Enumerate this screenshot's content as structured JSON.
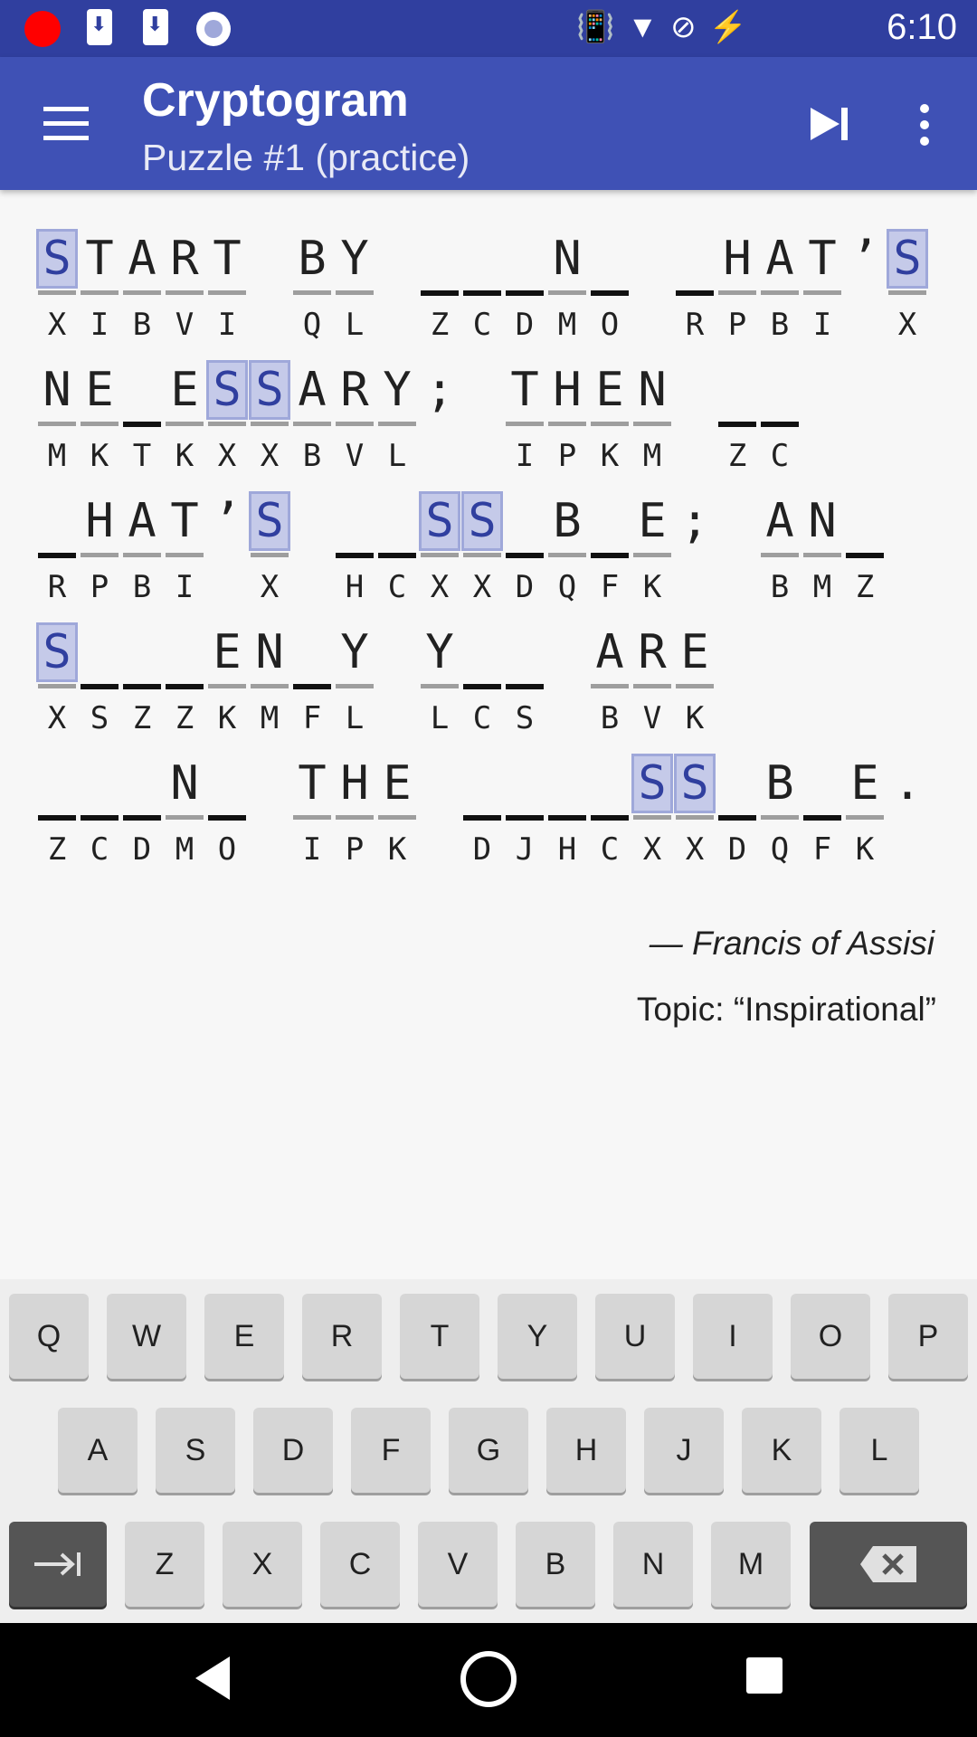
{
  "status_bar": {
    "time": "6:10"
  },
  "app_bar": {
    "title": "Cryptogram",
    "subtitle": "Puzzle #1 (practice)"
  },
  "puzzle": {
    "lines": [
      [
        {
          "p": "S",
          "c": "X",
          "hl": true
        },
        {
          "p": "T",
          "c": "I"
        },
        {
          "p": "A",
          "c": "B"
        },
        {
          "p": "R",
          "c": "V"
        },
        {
          "p": "T",
          "c": "I"
        },
        {
          "sp": true
        },
        {
          "p": "B",
          "c": "Q"
        },
        {
          "p": "Y",
          "c": "L"
        },
        {
          "sp": true
        },
        {
          "p": "",
          "c": "Z"
        },
        {
          "p": "",
          "c": "C"
        },
        {
          "p": "",
          "c": "D"
        },
        {
          "p": "N",
          "c": "M"
        },
        {
          "p": "",
          "c": "O"
        },
        {
          "sp": true
        },
        {
          "p": "",
          "c": "R"
        },
        {
          "p": "H",
          "c": "P"
        },
        {
          "p": "A",
          "c": "B"
        },
        {
          "p": "T",
          "c": "I"
        },
        {
          "p": "’",
          "punct": true
        },
        {
          "p": "S",
          "c": "X",
          "hl": true
        }
      ],
      [
        {
          "p": "N",
          "c": "M"
        },
        {
          "p": "E",
          "c": "K"
        },
        {
          "p": "",
          "c": "T"
        },
        {
          "p": "E",
          "c": "K"
        },
        {
          "p": "S",
          "c": "X",
          "hl": true
        },
        {
          "p": "S",
          "c": "X",
          "hl": true
        },
        {
          "p": "A",
          "c": "B"
        },
        {
          "p": "R",
          "c": "V"
        },
        {
          "p": "Y",
          "c": "L"
        },
        {
          "p": ";",
          "punct": true
        },
        {
          "sp": true
        },
        {
          "p": "T",
          "c": "I"
        },
        {
          "p": "H",
          "c": "P"
        },
        {
          "p": "E",
          "c": "K"
        },
        {
          "p": "N",
          "c": "M"
        },
        {
          "sp": true
        },
        {
          "p": "",
          "c": "Z"
        },
        {
          "p": "",
          "c": "C"
        }
      ],
      [
        {
          "p": "",
          "c": "R"
        },
        {
          "p": "H",
          "c": "P"
        },
        {
          "p": "A",
          "c": "B"
        },
        {
          "p": "T",
          "c": "I"
        },
        {
          "p": "’",
          "punct": true
        },
        {
          "p": "S",
          "c": "X",
          "hl": true
        },
        {
          "sp": true
        },
        {
          "p": "",
          "c": "H"
        },
        {
          "p": "",
          "c": "C"
        },
        {
          "p": "S",
          "c": "X",
          "hl": true
        },
        {
          "p": "S",
          "c": "X",
          "hl": true
        },
        {
          "p": "",
          "c": "D"
        },
        {
          "p": "B",
          "c": "Q"
        },
        {
          "p": "",
          "c": "F"
        },
        {
          "p": "E",
          "c": "K"
        },
        {
          "p": ";",
          "punct": true
        },
        {
          "sp": true
        },
        {
          "p": "A",
          "c": "B"
        },
        {
          "p": "N",
          "c": "M"
        },
        {
          "p": "",
          "c": "Z"
        }
      ],
      [
        {
          "p": "S",
          "c": "X",
          "hl": true
        },
        {
          "p": "",
          "c": "S"
        },
        {
          "p": "",
          "c": "Z"
        },
        {
          "p": "",
          "c": "Z"
        },
        {
          "p": "E",
          "c": "K"
        },
        {
          "p": "N",
          "c": "M"
        },
        {
          "p": "",
          "c": "F"
        },
        {
          "p": "Y",
          "c": "L"
        },
        {
          "sp": true
        },
        {
          "p": "Y",
          "c": "L"
        },
        {
          "p": "",
          "c": "C"
        },
        {
          "p": "",
          "c": "S"
        },
        {
          "sp": true
        },
        {
          "p": "A",
          "c": "B"
        },
        {
          "p": "R",
          "c": "V"
        },
        {
          "p": "E",
          "c": "K"
        }
      ],
      [
        {
          "p": "",
          "c": "Z"
        },
        {
          "p": "",
          "c": "C"
        },
        {
          "p": "",
          "c": "D"
        },
        {
          "p": "N",
          "c": "M"
        },
        {
          "p": "",
          "c": "O"
        },
        {
          "sp": true
        },
        {
          "p": "T",
          "c": "I"
        },
        {
          "p": "H",
          "c": "P"
        },
        {
          "p": "E",
          "c": "K"
        },
        {
          "sp": true
        },
        {
          "p": "",
          "c": "D"
        },
        {
          "p": "",
          "c": "J"
        },
        {
          "p": "",
          "c": "H"
        },
        {
          "p": "",
          "c": "C"
        },
        {
          "p": "S",
          "c": "X",
          "hl": true
        },
        {
          "p": "S",
          "c": "X",
          "hl": true
        },
        {
          "p": "",
          "c": "D"
        },
        {
          "p": "B",
          "c": "Q"
        },
        {
          "p": "",
          "c": "F"
        },
        {
          "p": "E",
          "c": "K"
        },
        {
          "p": ".",
          "punct": true
        }
      ]
    ],
    "author": "— Francis of Assisi",
    "topic": "Topic: “Inspirational”"
  },
  "keyboard": {
    "rows": [
      [
        "Q",
        "W",
        "E",
        "R",
        "T",
        "Y",
        "U",
        "I",
        "O",
        "P"
      ],
      [
        "A",
        "S",
        "D",
        "F",
        "G",
        "H",
        "J",
        "K",
        "L"
      ],
      [
        "Z",
        "X",
        "C",
        "V",
        "B",
        "N",
        "M"
      ]
    ],
    "tab_icon": "tab-icon",
    "backspace_icon": "backspace-icon"
  },
  "colors": {
    "status_bar": "#303f9f",
    "app_bar": "#3f51b5",
    "highlight": "#c5cae9",
    "keyboard_bg": "#eeeeee",
    "key_bg": "#d6d6d6"
  }
}
